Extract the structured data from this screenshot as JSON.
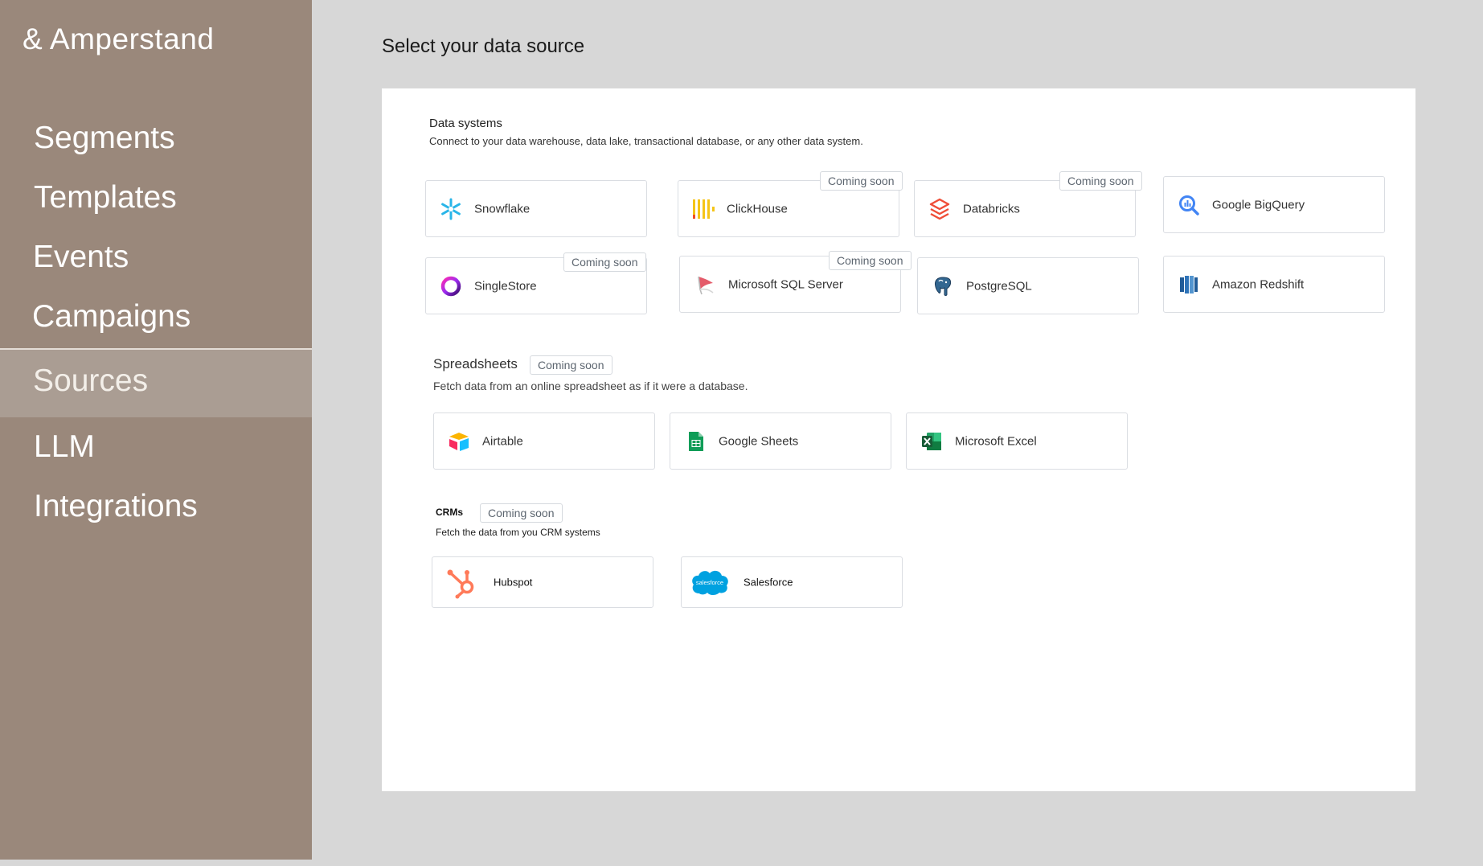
{
  "app": {
    "brand": "& Amperstand"
  },
  "nav": {
    "items": [
      {
        "label": "Segments"
      },
      {
        "label": "Templates"
      },
      {
        "label": "Events"
      },
      {
        "label": "Campaigns"
      },
      {
        "label": "Sources"
      },
      {
        "label": "LLM"
      },
      {
        "label": "Integrations"
      }
    ],
    "active": "Sources"
  },
  "page": {
    "title": "Select your data source"
  },
  "badge_label": "Coming soon",
  "data_systems": {
    "title": "Data systems",
    "description": "Connect to your data warehouse, data lake, transactional database, or any other data system.",
    "sources": [
      {
        "label": "Snowflake",
        "icon": "snowflake-icon",
        "coming_soon": false
      },
      {
        "label": "ClickHouse",
        "icon": "clickhouse-icon",
        "coming_soon": true
      },
      {
        "label": "Databricks",
        "icon": "databricks-icon",
        "coming_soon": true
      },
      {
        "label": "Google BigQuery",
        "icon": "bigquery-icon",
        "coming_soon": false
      },
      {
        "label": "SingleStore",
        "icon": "singlestore-icon",
        "coming_soon": true
      },
      {
        "label": "Microsoft SQL Server",
        "icon": "sql-server-icon",
        "coming_soon": true
      },
      {
        "label": "PostgreSQL",
        "icon": "postgresql-icon",
        "coming_soon": false
      },
      {
        "label": "Amazon Redshift",
        "icon": "redshift-icon",
        "coming_soon": false
      }
    ]
  },
  "spreadsheets": {
    "title": "Spreadsheets",
    "coming_soon": true,
    "description": "Fetch data from an online spreadsheet as if it were a database.",
    "sources": [
      {
        "label": "Airtable",
        "icon": "airtable-icon"
      },
      {
        "label": "Google Sheets",
        "icon": "google-sheets-icon"
      },
      {
        "label": "Microsoft Excel",
        "icon": "excel-icon"
      }
    ]
  },
  "crms": {
    "title": "CRMs",
    "coming_soon": true,
    "description": "Fetch the data from you CRM systems",
    "sources": [
      {
        "label": "Hubspot",
        "icon": "hubspot-icon"
      },
      {
        "label": "Salesforce",
        "icon": "salesforce-icon",
        "logo_text": "salesforce"
      }
    ]
  },
  "colors": {
    "sidebar": "#9a887b",
    "sidebar_active": "#aa9d93",
    "page_background": "#d7d7d7",
    "panel": "#ffffff"
  }
}
